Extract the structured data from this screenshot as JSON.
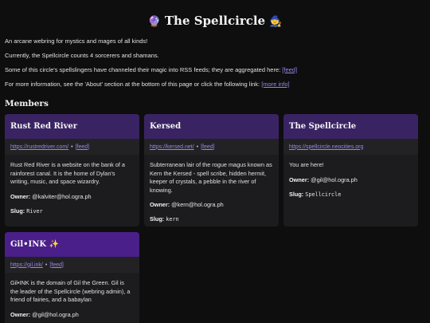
{
  "header": {
    "title": "The Spellcircle",
    "emoji_left": "🔮",
    "emoji_right": "🧙"
  },
  "intro": {
    "line1": "An arcane webring for mystics and mages of all kinds!",
    "line2": "Currently, the Spellcircle counts 4 sorcerers and shamans.",
    "line3_text": "Some of this circle's spellslingers have channeled their magic into RSS feeds; they are aggregated here: ",
    "line3_link": "[feed]",
    "line4_text": "For more information, see the 'About' section at the bottom of this page or click the following link: ",
    "line4_link": "[more info]"
  },
  "members_heading": "Members",
  "members": [
    {
      "name": "Rust Red River",
      "url": "https://rustredriver.com/",
      "feed": "[feed]",
      "separator": "•",
      "description": "Rust Red River is a website on the bank of a rainforest canal. It is the home of Dylan's writing, music, and space wizardry.",
      "owner_label": "Owner:",
      "owner": "@kalviter@hol.ogra.ph",
      "slug_label": "Slug:",
      "slug": "River"
    },
    {
      "name": "Kersed",
      "url": "https://kersed.net/",
      "feed": "[feed]",
      "separator": "•",
      "description": "Subterranean lair of the rogue magus known as Kern the Kersed - spell scribe, hidden hermit, keeper of crystals, a pebble in the river of knowing.",
      "owner_label": "Owner:",
      "owner": "@kern@hol.ogra.ph",
      "slug_label": "Slug:",
      "slug": "kern"
    },
    {
      "name": "The Spellcircle",
      "url": "https://spellcircle.neocities.org",
      "description": "You are here!",
      "owner_label": "Owner:",
      "owner": "@gil@hol.ogra.ph",
      "slug_label": "Slug:",
      "slug": "Spellcircle"
    },
    {
      "name": "Gil•INK ✨",
      "url": "https://gil.ink/",
      "feed": "[feed]",
      "separator": "•",
      "description": "Gil•INK is the domain of Gil the Green. Gil is the leader of the Spellcircle (webring admin), a friend of fairies, and a babaylan",
      "owner_label": "Owner:",
      "owner": "@gil@hol.ogra.ph"
    }
  ],
  "colors": {
    "background": "#0e0e0f",
    "card_header": "#3a2363",
    "card_header_bright": "#4a1f8a",
    "link": "#9a86e8"
  }
}
